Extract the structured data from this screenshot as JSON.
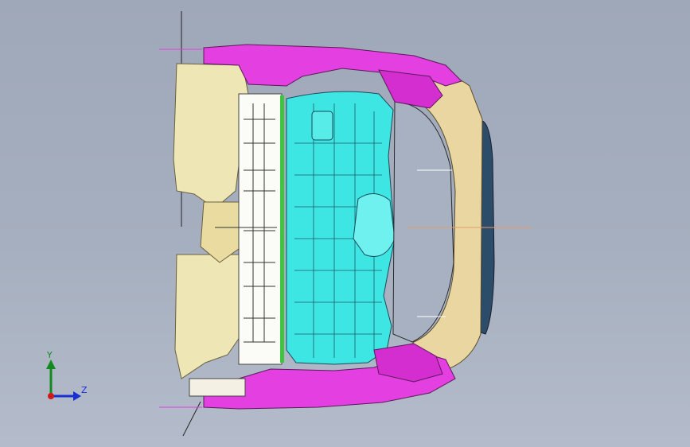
{
  "viewport": {
    "background_top": "#9fa8b9",
    "background_bottom": "#b4bccb"
  },
  "model": {
    "description_colors": {
      "bumper_magenta": "#e43fe0",
      "interior_cyan": "#3ee6e3",
      "trim_beige": "#eee6b4",
      "dark_edge": "#1a1a2a",
      "center_line": "#e89a6a",
      "seat_white": "#ffffff",
      "glass_dark": "#2c4d6a"
    }
  },
  "triad": {
    "y_label": "Y",
    "z_label": "Z",
    "x_origin_color": "#d01a1a",
    "y_color": "#138a1f",
    "z_color": "#1a2fd0"
  }
}
